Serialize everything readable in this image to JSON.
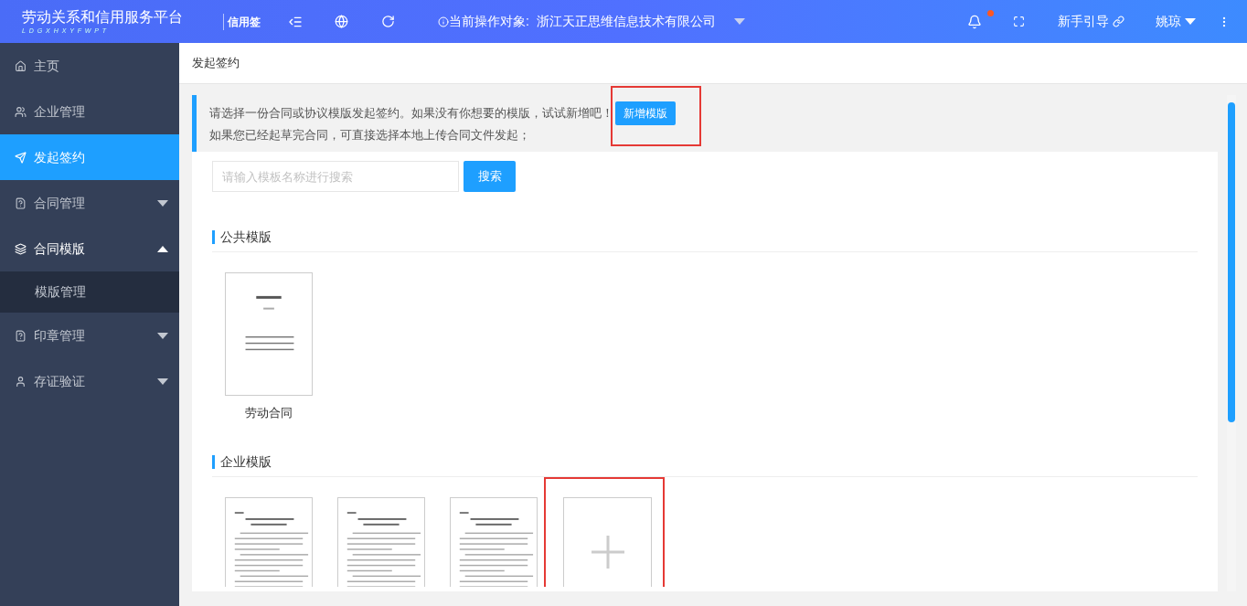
{
  "header": {
    "logo_title": "劳动关系和信用服务平台",
    "logo_subtitle": "L D G X H X Y F W P T",
    "product": "信用签",
    "target_label": "当前操作对象:",
    "target_value": "浙江天正思维信息技术有限公司",
    "notification_dot": true,
    "guide": "新手引导",
    "user": "姚琼"
  },
  "sidebar": {
    "items": [
      {
        "label": "主页",
        "kind": "link",
        "selected": false
      },
      {
        "label": "企业管理",
        "kind": "link",
        "selected": false
      },
      {
        "label": "发起签约",
        "kind": "link",
        "selected": true
      },
      {
        "label": "合同管理",
        "kind": "group",
        "selected": false,
        "expanded": false
      },
      {
        "label": "合同模版",
        "kind": "group",
        "selected": false,
        "expanded": true,
        "children": [
          {
            "label": "模版管理",
            "selected": false
          }
        ]
      },
      {
        "label": "印章管理",
        "kind": "group",
        "selected": false,
        "expanded": false
      },
      {
        "label": "存证验证",
        "kind": "group",
        "selected": false,
        "expanded": false
      }
    ]
  },
  "breadcrumb": "发起签约",
  "notice": {
    "line_1": "请选择一份合同或协议模版发起签约。如果没有你想要的模版，试试新增吧！",
    "add_button": "新增模版",
    "line_2": "如果您已经起草完合同，可直接选择本地上传合同文件发起；"
  },
  "search": {
    "placeholder": "请输入模板名称进行搜索",
    "button": "搜索"
  },
  "public_templates": {
    "title": "公共模版",
    "items": [
      {
        "name": "劳动合同"
      }
    ]
  },
  "company_templates": {
    "title": "企业模版",
    "items": [
      {
        "kind": "document"
      },
      {
        "kind": "document"
      },
      {
        "kind": "document"
      },
      {
        "kind": "add"
      }
    ]
  }
}
